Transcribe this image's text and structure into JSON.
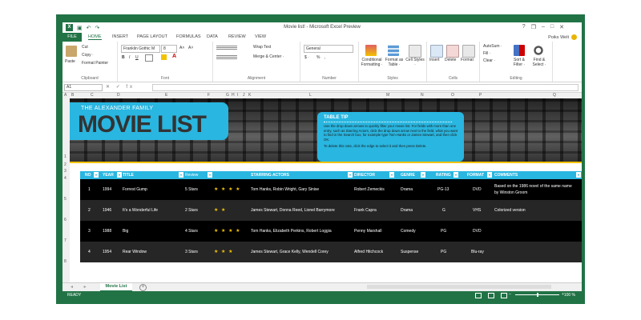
{
  "window": {
    "title": "Movie list! - Microsoft Excel Preview",
    "controls": [
      "?",
      "❒",
      "–",
      "□",
      "✕"
    ],
    "user": "Poiks Welt"
  },
  "quick_access": {
    "app_icon": "X",
    "save": "💾",
    "undo": "↶",
    "redo": "↷"
  },
  "ribbon_tabs": [
    "FILE",
    "HOME",
    "INSERT",
    "PAGE LAYOUT",
    "FORMULAS",
    "DATA",
    "REVIEW",
    "VIEW"
  ],
  "ribbon": {
    "clipboard": {
      "paste": "Paste",
      "cut": "Cut",
      "copy": "Copy ·",
      "format_painter": "Format Painter",
      "label": "Clipboard"
    },
    "font": {
      "family": "Franklin Gothic M",
      "size": "8",
      "bold": "B",
      "italic": "I",
      "underline": "U",
      "grow": "A˄",
      "shrink": "A˅",
      "label": "Font"
    },
    "alignment": {
      "wrap": "Wrap Text",
      "merge": "Merge & Center ·",
      "label": "Alignment"
    },
    "number": {
      "format": "General",
      "currency": "$ ·",
      "percent": "%",
      "comma": ",",
      "label": "Number"
    },
    "styles": {
      "conditional": "Conditional Formatting ·",
      "format_table": "Format as Table ·",
      "cell_styles": "Cell Styles ·",
      "label": "Styles"
    },
    "cells": {
      "insert": "Insert",
      "delete": "Delete",
      "format": "Format",
      "label": "Cells"
    },
    "editing": {
      "autosum": "AutoSum ·",
      "fill": "Fill ·",
      "clear": "Clear ·",
      "sort": "Sort & Filter ·",
      "find": "Find & Select ·",
      "label": "Editing"
    }
  },
  "formula_bar": {
    "cell_ref": "A1",
    "fx": "✕ ✓ fx",
    "value": ""
  },
  "columns": [
    "A",
    "B",
    "C",
    "D",
    "E",
    "F",
    "G",
    "H",
    "I",
    "J",
    "K",
    "L",
    "M",
    "N",
    "O",
    "P",
    "Q"
  ],
  "rows": [
    "1",
    "2",
    "3",
    "4",
    "5",
    "6",
    "7",
    "8"
  ],
  "banner": {
    "family": "THE ALEXANDER FAMILY",
    "title": "MOVIE LIST",
    "tip_title": "TABLE TIP",
    "tip_text": "Use the drop down arrows to quickly filter your movie list. For fields with more than one entry, such as Starring Actors, click the drop down arrow next to the field, what you want to find in the Search box, for example type Tom Hanks or James Stewart, and then click OK.",
    "tip_text2": "To delete this note, click the edge to select it and then press Delete."
  },
  "table": {
    "headers": [
      "NO",
      "YEAR",
      "TITLE",
      "Review",
      "STARRING ACTORS",
      "DIRECTOR",
      "GENRE",
      "RATING",
      "FORMAT",
      "COMMENTS"
    ],
    "rows": [
      {
        "no": "1",
        "year": "1994",
        "title": "Forrest Gump",
        "review": "5 Stars",
        "stars": "★ ★ ★ ★",
        "actors": "Tom Hanks, Robin Wright, Gary Sinise",
        "director": "Robert Zemeckis",
        "genre": "Drama",
        "rating": "PG-13",
        "format": "DVD",
        "comments": "Based on the 1986 novel of the same name by Winston Groom"
      },
      {
        "no": "2",
        "year": "1946",
        "title": "It’s a Wonderful Life",
        "review": "2 Stars",
        "stars": "★ ★",
        "actors": "James Stewart, Donna Reed, Lionel Barrymore",
        "director": "Frank Capra",
        "genre": "Drama",
        "rating": "G",
        "format": "VHS",
        "comments": "Colorized version"
      },
      {
        "no": "3",
        "year": "1988",
        "title": "Big",
        "review": "4 Stars",
        "stars": "★ ★ ★ ★",
        "actors": "Tom Hanks, Elizabeth Perkins, Robert Loggia",
        "director": "Penny Marshall",
        "genre": "Comedy",
        "rating": "PG",
        "format": "DVD",
        "comments": ""
      },
      {
        "no": "4",
        "year": "1954",
        "title": "Rear Window",
        "review": "3 Stars",
        "stars": "★ ★ ★",
        "actors": "James Stewart, Grace Kelly, Wendell Corey",
        "director": "Alfred Hitchcock",
        "genre": "Suspense",
        "rating": "PG",
        "format": "Blu-ray",
        "comments": ""
      }
    ]
  },
  "sheet_tabs": {
    "active": "Movie List",
    "add": "+",
    "nav": "◂ ▸"
  },
  "status": {
    "ready": "READY",
    "zoom": "100 %",
    "minus": "–",
    "plus": "+"
  },
  "colors": {
    "excel_green": "#217346",
    "accent_blue": "#29b6e0",
    "accent_yellow": "#f2c200"
  }
}
